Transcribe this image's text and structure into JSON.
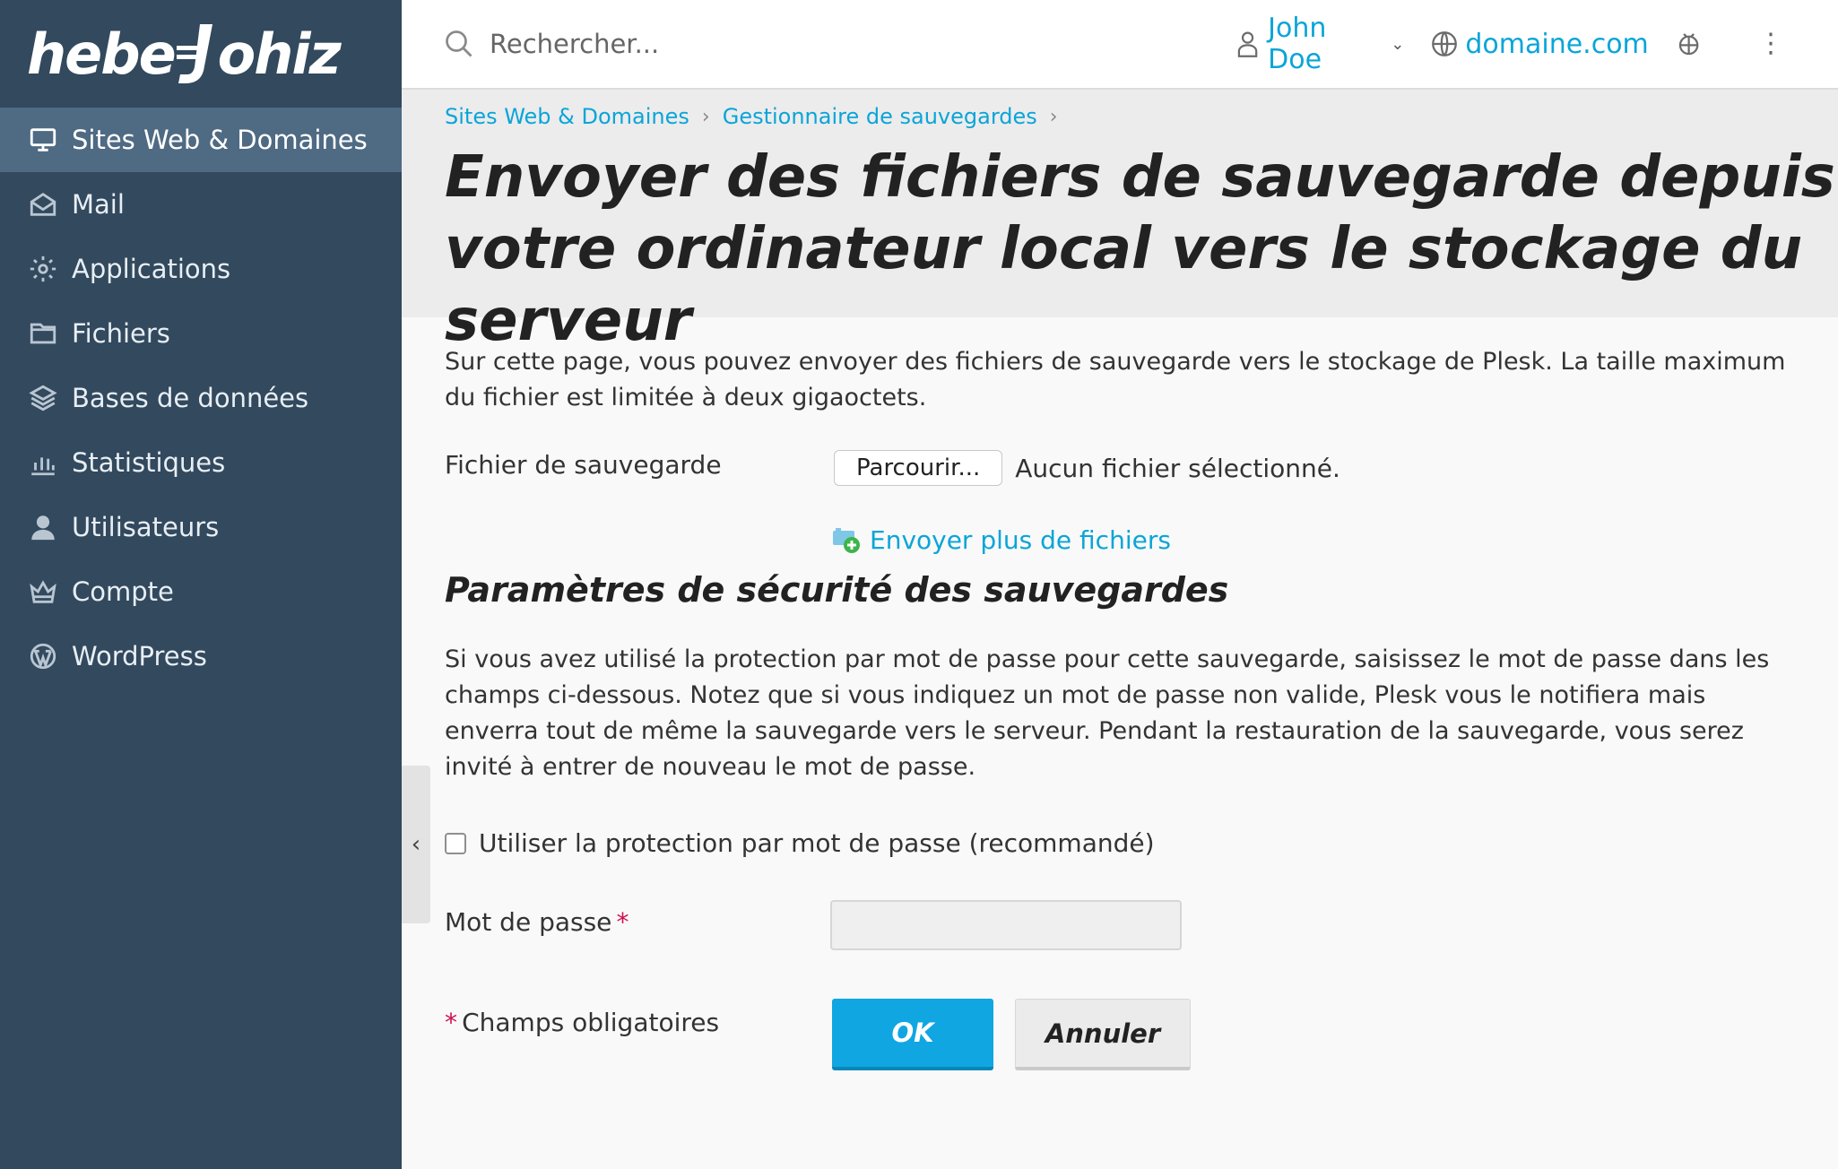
{
  "brand": {
    "logo_left": "hebe",
    "logo_right": "ohiz"
  },
  "sidebar": {
    "items": [
      {
        "label": "Sites Web & Domaines",
        "icon": "monitor-icon",
        "active": true
      },
      {
        "label": "Mail",
        "icon": "mail-icon"
      },
      {
        "label": "Applications",
        "icon": "gear-icon"
      },
      {
        "label": "Fichiers",
        "icon": "folder-icon"
      },
      {
        "label": "Bases de données",
        "icon": "database-layers-icon"
      },
      {
        "label": "Statistiques",
        "icon": "bar-chart-icon"
      },
      {
        "label": "Utilisateurs",
        "icon": "user-icon"
      },
      {
        "label": "Compte",
        "icon": "crown-icon"
      },
      {
        "label": "WordPress",
        "icon": "wordpress-icon"
      }
    ]
  },
  "header": {
    "search_placeholder": "Rechercher...",
    "user_name": "John Doe",
    "domain": "domaine.com"
  },
  "breadcrumb": {
    "items": [
      "Sites Web & Domaines",
      "Gestionnaire de sauvegardes"
    ]
  },
  "page": {
    "title": "Envoyer des fichiers de sauvegarde depuis votre ordinateur local vers le stockage du serveur",
    "intro": "Sur cette page, vous pouvez envoyer des fichiers de sauvegarde vers le stockage de Plesk. La taille maximum du fichier est limitée à deux gigaoctets."
  },
  "form": {
    "backup_file_label": "Fichier de sauvegarde",
    "browse_label": "Parcourir...",
    "no_file_text": "Aucun fichier sélectionné.",
    "more_files_label": "Envoyer plus de fichiers",
    "security_title": "Paramètres de sécurité des sauvegardes",
    "security_text": "Si vous avez utilisé la protection par mot de passe pour cette sauvegarde, saisissez le mot de passe dans les champs ci-dessous. Notez que si vous indiquez un mot de passe non valide, Plesk vous le notifiera mais enverra tout de même la sauvegarde vers le serveur. Pendant la restauration de la sauvegarde, vous serez invité à entrer de nouveau le mot de passe.",
    "use_password_label": "Utiliser la protection par mot de passe (recommandé)",
    "use_password_checked": false,
    "password_label": "Mot de passe",
    "required_mark": "*",
    "required_note": "Champs obligatoires",
    "password_value": "",
    "ok_label": "OK",
    "cancel_label": "Annuler"
  },
  "colors": {
    "sidebar_bg": "#32495e",
    "sidebar_active": "#4f6a83",
    "link": "#0aa5d8",
    "primary_button": "#10a6e2",
    "required": "#d0104c"
  }
}
